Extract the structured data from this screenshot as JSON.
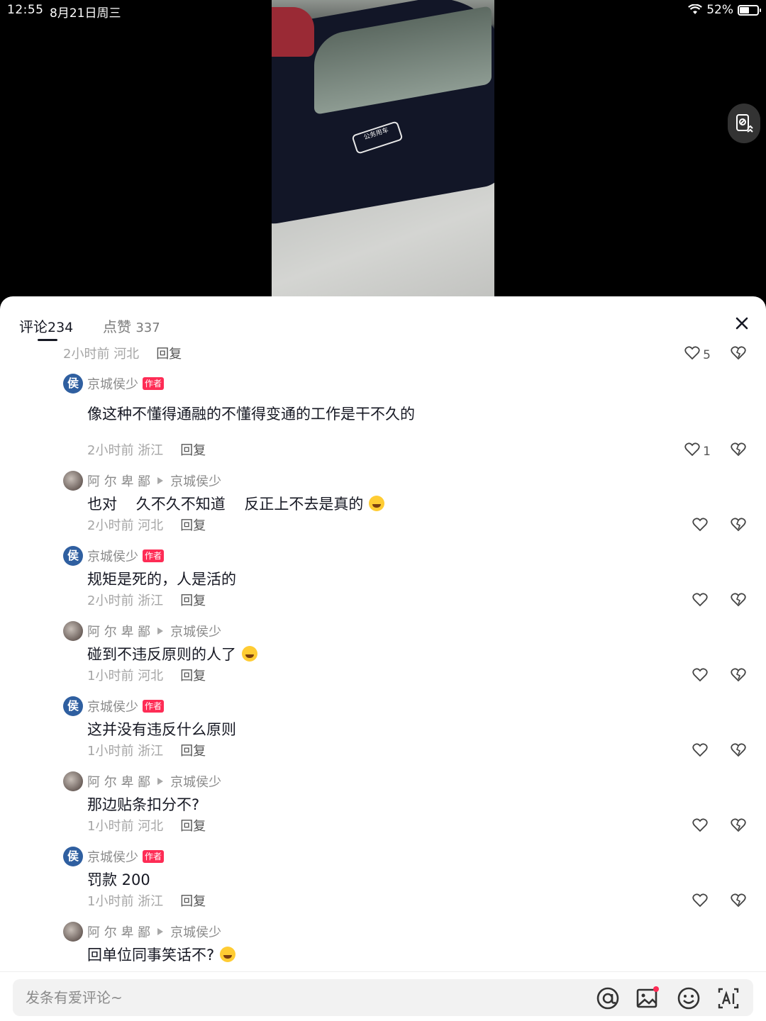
{
  "status_bar": {
    "time": "12:55",
    "date": "8月21日周三",
    "battery": "52%"
  },
  "video": {
    "badge_text": "公务用车"
  },
  "tabs": [
    {
      "label": "评论",
      "count": "234"
    },
    {
      "label": "点赞",
      "count": "337"
    }
  ],
  "comments": [
    {
      "kind": "meta-only",
      "time": "2小时前",
      "location": "河北",
      "reply": "回复",
      "likes": "5"
    },
    {
      "kind": "author",
      "user": "京城侯少",
      "tag": "作者",
      "text": "像这种不懂得通融的不懂得变通的工作是干不久的",
      "time": "2小时前",
      "location": "浙江",
      "reply": "回复",
      "likes": "1"
    },
    {
      "kind": "reply",
      "user": "阿 尔 卑 鄙",
      "reply_to": "京城侯少",
      "text": "也对    久不久不知道    反正上不去是真的",
      "emoji": "laugh-emoji",
      "time": "2小时前",
      "location": "河北",
      "reply": "回复",
      "likes": ""
    },
    {
      "kind": "author",
      "user": "京城侯少",
      "tag": "作者",
      "text": "规矩是死的，人是活的",
      "time": "2小时前",
      "location": "浙江",
      "reply": "回复",
      "likes": ""
    },
    {
      "kind": "reply",
      "user": "阿 尔 卑 鄙",
      "reply_to": "京城侯少",
      "text": "碰到不违反原则的人了",
      "emoji": "laugh-emoji",
      "time": "1小时前",
      "location": "河北",
      "reply": "回复",
      "likes": ""
    },
    {
      "kind": "author",
      "user": "京城侯少",
      "tag": "作者",
      "text": "这并没有违反什么原则",
      "time": "1小时前",
      "location": "浙江",
      "reply": "回复",
      "likes": ""
    },
    {
      "kind": "reply",
      "user": "阿 尔 卑 鄙",
      "reply_to": "京城侯少",
      "text": "那边贴条扣分不?",
      "time": "1小时前",
      "location": "河北",
      "reply": "回复",
      "likes": ""
    },
    {
      "kind": "author",
      "user": "京城侯少",
      "tag": "作者",
      "text": "罚款 200",
      "time": "1小时前",
      "location": "浙江",
      "reply": "回复",
      "likes": ""
    },
    {
      "kind": "reply",
      "user": "阿 尔 卑 鄙",
      "reply_to": "京城侯少",
      "text": "回单位同事笑话不?",
      "emoji": "laugh-emoji",
      "time": "",
      "location": "",
      "reply": "",
      "likes": ""
    }
  ],
  "input": {
    "placeholder": "发条有爱评论~"
  },
  "icons": [
    "wifi-icon",
    "battery-icon",
    "screen-rotate-icon",
    "close-icon",
    "heart-icon",
    "dislike-icon",
    "at-icon",
    "image-icon",
    "emoji-icon",
    "ai-icon"
  ],
  "colors": {
    "author_tag": "#fe2c55",
    "avatar_author": "#2f5fa0",
    "image_icon_dot": "#fe2c55"
  }
}
